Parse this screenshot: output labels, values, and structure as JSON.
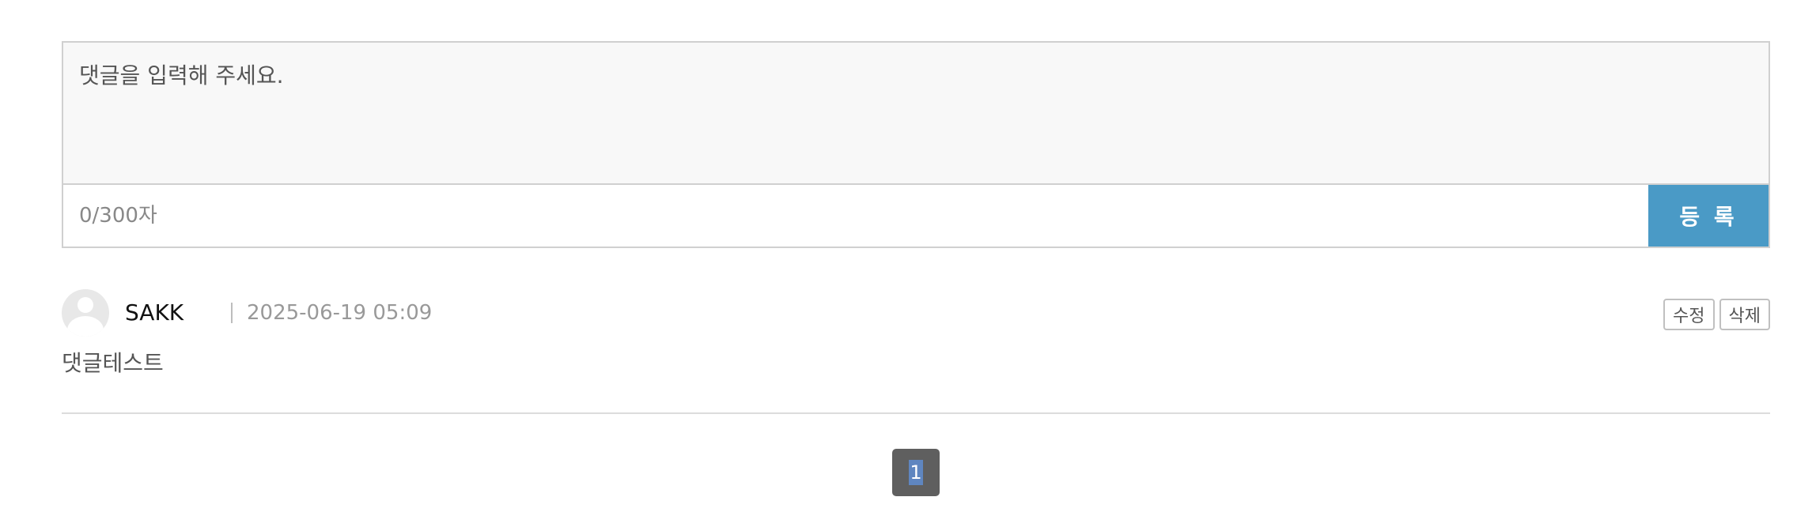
{
  "comment_form": {
    "placeholder": "댓글을 입력해 주세요.",
    "char_count": "0/300자",
    "submit_label": "등 록"
  },
  "comments": [
    {
      "author": "SAKK",
      "date": "2025-06-19 05:09",
      "text": "댓글테스트",
      "edit_label": "수정",
      "delete_label": "삭제"
    }
  ],
  "pagination": {
    "current_page": "1"
  },
  "colors": {
    "accent": "#4a9ac6",
    "pagination_active": "#5f5f5f"
  }
}
